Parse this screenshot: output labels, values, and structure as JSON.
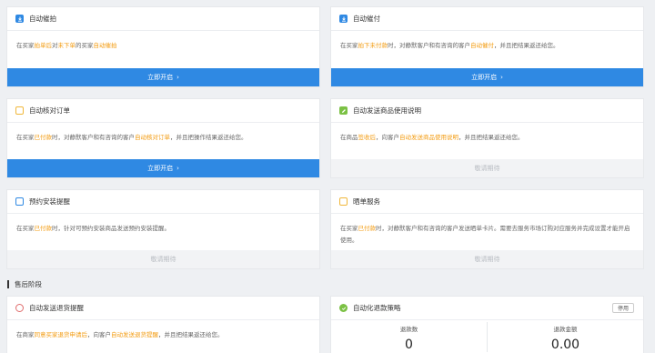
{
  "cards": [
    {
      "title": "自动催拍",
      "icon": "download-icon",
      "icon_color": "#2f89e3",
      "desc": [
        {
          "t": "在买家",
          "h": false
        },
        {
          "t": "拍单后",
          "h": true
        },
        {
          "t": "对",
          "h": false
        },
        {
          "t": "未下单",
          "h": true
        },
        {
          "t": "的买家",
          "h": false
        },
        {
          "t": "自动催拍",
          "h": true
        }
      ],
      "button": "立即开启",
      "button_enabled": true
    },
    {
      "title": "自动催付",
      "icon": "download-icon",
      "icon_color": "#2f89e3",
      "desc": [
        {
          "t": "在买家",
          "h": false
        },
        {
          "t": "拍下未付款",
          "h": true
        },
        {
          "t": "时，对静默客户和有咨询的客户",
          "h": false
        },
        {
          "t": "自动催付",
          "h": true
        },
        {
          "t": "，并且把结果返还给您。",
          "h": false
        }
      ],
      "button": "立即开启",
      "button_enabled": true
    },
    {
      "title": "自动核对订单",
      "icon": "order-icon",
      "icon_color": "#f0b73a",
      "desc": [
        {
          "t": "在买家",
          "h": false
        },
        {
          "t": "已付款",
          "h": true
        },
        {
          "t": "时，对静默客户和有咨询的客户",
          "h": false
        },
        {
          "t": "自动核对订单",
          "h": true
        },
        {
          "t": "，并且把操作结果返还给您。",
          "h": false
        }
      ],
      "button": "立即开启",
      "button_enabled": true
    },
    {
      "title": "自动发送商品使用说明",
      "icon": "pencil-icon",
      "icon_color": "#7bc144",
      "desc": [
        {
          "t": "在商品",
          "h": false
        },
        {
          "t": "签收后",
          "h": true
        },
        {
          "t": "，向客户",
          "h": false
        },
        {
          "t": "自动发送商品使用说明",
          "h": true
        },
        {
          "t": "，并且把结果返还给您。",
          "h": false
        }
      ],
      "button": "敬请期待",
      "button_enabled": false
    },
    {
      "title": "预约安装提醒",
      "icon": "calendar-icon",
      "icon_color": "#2f89e3",
      "desc": [
        {
          "t": "在买家",
          "h": false
        },
        {
          "t": "已付款",
          "h": true
        },
        {
          "t": "时，针对可预约安装商品发送预约安装提醒。",
          "h": false
        }
      ],
      "button": "敬请期待",
      "button_enabled": false
    },
    {
      "title": "晒单服务",
      "icon": "order-icon",
      "icon_color": "#f0b73a",
      "desc": [
        {
          "t": "在买家",
          "h": false
        },
        {
          "t": "已付款",
          "h": true
        },
        {
          "t": "时，对静默客户和有咨询的客户发送晒单卡片。需要去服务市场订购对应服务并完成设置才能开启使用。",
          "h": false
        }
      ],
      "button": "敬请期待",
      "button_enabled": false
    },
    {
      "title": "自动发送退货提醒",
      "icon": "return-icon",
      "icon_color": "#e06b6b",
      "desc": [
        {
          "t": "在商家",
          "h": false
        },
        {
          "t": "同意买家退货申请后",
          "h": true
        },
        {
          "t": "，向客户",
          "h": false
        },
        {
          "t": "自动发送退货提醒",
          "h": true
        },
        {
          "t": "，并且把结果返还给您。",
          "h": false
        }
      ]
    },
    {
      "title": "自动化退款策略",
      "icon": "check-circle-icon",
      "icon_color": "#7bc144",
      "stop_label": "停用",
      "stats": [
        {
          "label": "退款数",
          "value": "0"
        },
        {
          "label": "退款金额",
          "value": "0.00"
        }
      ]
    }
  ],
  "section": {
    "title": "售后阶段"
  }
}
